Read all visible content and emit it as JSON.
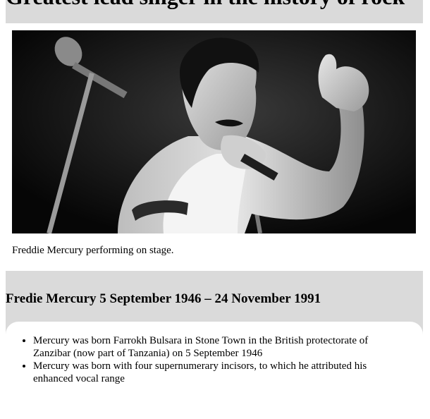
{
  "page": {
    "title": "Greatest lead singer in the history of rock"
  },
  "figure": {
    "photo_subject": "Freddie Mercury, black-and-white, singing into a microphone with thumb raised",
    "caption": "Freddie Mercury performing on stage."
  },
  "bio": {
    "heading": "Fredie Mercury 5 September 1946 – 24 November 1991",
    "facts": [
      "Mercury was born Farrokh Bulsara in Stone Town in the British protectorate of Zanzibar (now part of Tanzania) on 5 September 1946",
      "Mercury was born with four supernumerary incisors, to which he attributed his enhanced vocal range"
    ]
  },
  "colors": {
    "section_background": "#dadada",
    "card_background": "#ffffff",
    "photo_background": "#0d0d0d"
  }
}
